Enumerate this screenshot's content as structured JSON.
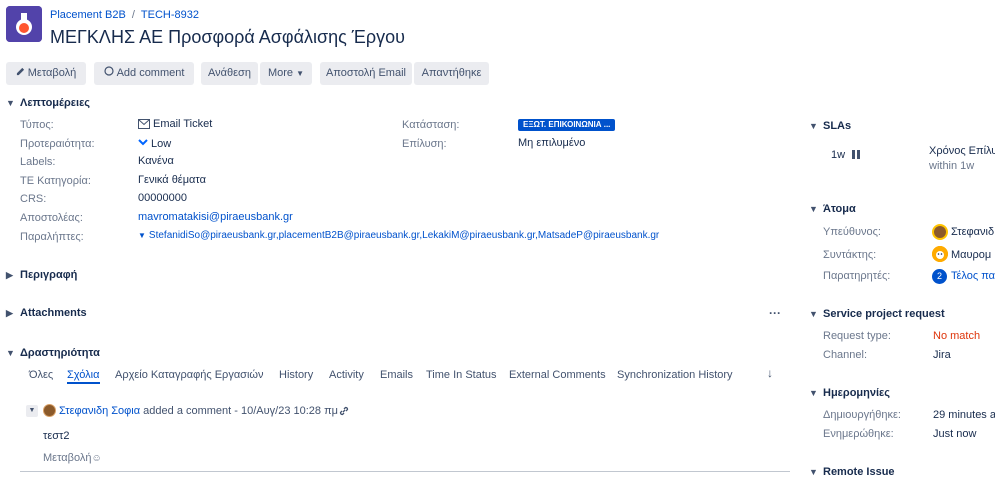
{
  "header": {
    "project": "Placement B2B",
    "separator": "/",
    "issue_key": "TECH-8932",
    "title": "ΜΕΓΚΛΗΣ ΑΕ Προσφορά Ασφάλισης Έργου"
  },
  "toolbar": {
    "edit": "Μεταβολή",
    "add_comment": "Add comment",
    "assign": "Ανάθεση",
    "more": "More",
    "send_email": "Αποστολή Email",
    "replied": "Απαντήθηκε"
  },
  "details": {
    "section_title": "Λεπτομέρειες",
    "fields": [
      {
        "label": "Τύπος:",
        "value": "Email Ticket"
      },
      {
        "label": "Προτεραιότητα:",
        "value": "Low"
      },
      {
        "label": "Labels:",
        "value": "Κανένα"
      },
      {
        "label": "ΤΕ Κατηγορία:",
        "value": "Γενικά θέματα"
      },
      {
        "label": "CRS:",
        "value": "00000000"
      },
      {
        "label": "Αποστολέας:",
        "value": "mavromatakisi@piraeusbank.gr"
      },
      {
        "label": "Παραλήπτες:",
        "value": "StefanidiSo@piraeusbank.gr,placementB2B@piraeusbank.gr,LekakiM@piraeusbank.gr,MatsadeP@piraeusbank.gr"
      }
    ],
    "right_fields": [
      {
        "label": "Κατάσταση:",
        "value": "ΕΞΩΤ. ΕΠΙΚΟΙΝΩΝΙΑ ..."
      },
      {
        "label": "Επίλυση:",
        "value": "Μη επιλυμένο"
      }
    ]
  },
  "sections": {
    "description": "Περιγραφή",
    "attachments": "Attachments",
    "attachments_more": "···",
    "activity": "Δραστηριότητα"
  },
  "activity_tabs": [
    "Όλες",
    "Σχόλια",
    "Αρχείο Καταγραφής Εργασιών",
    "History",
    "Activity",
    "Emails",
    "Time In Status",
    "External Comments",
    "Synchronization History"
  ],
  "comment": {
    "author": "Στεφανιδη Σοφια",
    "action": "added a comment - 10/Αυγ/23 10:28 πμ",
    "body": "τεστ2",
    "edit": "Μεταβολή"
  },
  "sidebar": {
    "slas": {
      "title": "SLAs",
      "duration": "1w",
      "metric": "Χρόνος Επίλυ",
      "within": "within 1w"
    },
    "people": {
      "title": "Άτομα",
      "assignee_label": "Υπεύθυνος:",
      "assignee": "Στεφανιδ",
      "reporter_label": "Συντάκτης:",
      "reporter": "Μαυρομ",
      "watchers_label": "Παρατηρητές:",
      "watchers_count": "2",
      "watchers_link": "Τέλος πα"
    },
    "service": {
      "title": "Service project request",
      "type_label": "Request type:",
      "type_value": "No match",
      "channel_label": "Channel:",
      "channel_value": "Jira"
    },
    "dates": {
      "title": "Ημερομηνίες",
      "created_label": "Δημιουργήθηκε:",
      "created_value": "29 minutes ag",
      "updated_label": "Ενημερώθηκε:",
      "updated_value": "Just now"
    },
    "remote": {
      "title": "Remote Issue"
    }
  },
  "colors": {
    "brand": "#0052cc",
    "project_icon": "#5243aa",
    "no_match": "#de350b"
  }
}
